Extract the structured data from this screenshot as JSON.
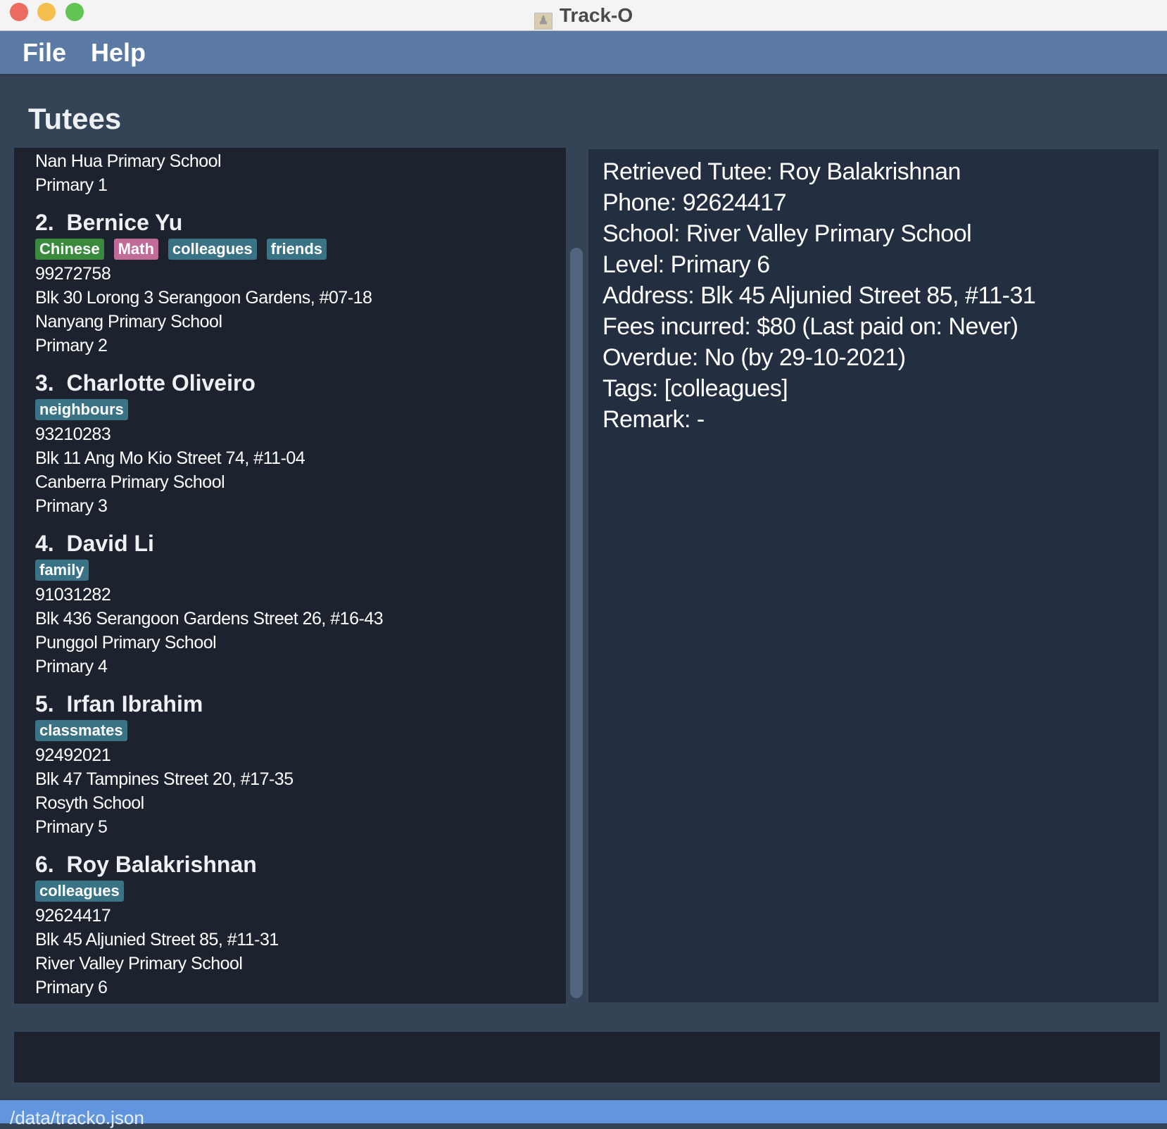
{
  "window": {
    "title": "Track-O"
  },
  "menu": {
    "file": "File",
    "help": "Help"
  },
  "panel": {
    "heading": "Tutees"
  },
  "partial_card": {
    "school": "Nan Hua Primary School",
    "level": "Primary 1"
  },
  "tutees": [
    {
      "index": "2.",
      "name": "Bernice Yu",
      "tags": [
        {
          "label": "Chinese",
          "color": "#3a8a3e"
        },
        {
          "label": "Math",
          "color": "#c06b98"
        },
        {
          "label": "colleagues",
          "color": "#3b7386"
        },
        {
          "label": "friends",
          "color": "#3b7386"
        }
      ],
      "phone": "99272758",
      "address": "Blk 30 Lorong 3 Serangoon Gardens, #07-18",
      "school": "Nanyang Primary School",
      "level": "Primary 2"
    },
    {
      "index": "3.",
      "name": "Charlotte Oliveiro",
      "tags": [
        {
          "label": "neighbours",
          "color": "#3b7386"
        }
      ],
      "phone": "93210283",
      "address": "Blk 11 Ang Mo Kio Street 74, #11-04",
      "school": "Canberra Primary School",
      "level": "Primary 3"
    },
    {
      "index": "4.",
      "name": "David Li",
      "tags": [
        {
          "label": "family",
          "color": "#3b7386"
        }
      ],
      "phone": "91031282",
      "address": "Blk 436 Serangoon Gardens Street 26, #16-43",
      "school": "Punggol Primary School",
      "level": "Primary 4"
    },
    {
      "index": "5.",
      "name": "Irfan Ibrahim",
      "tags": [
        {
          "label": "classmates",
          "color": "#3b7386"
        }
      ],
      "phone": "92492021",
      "address": "Blk 47 Tampines Street 20, #17-35",
      "school": "Rosyth School",
      "level": "Primary 5"
    },
    {
      "index": "6.",
      "name": "Roy Balakrishnan",
      "tags": [
        {
          "label": "colleagues",
          "color": "#3b7386"
        }
      ],
      "phone": "92624417",
      "address": "Blk 45 Aljunied Street 85, #11-31",
      "school": "River Valley Primary School",
      "level": "Primary 6"
    }
  ],
  "result": [
    "Retrieved Tutee: Roy Balakrishnan",
    "Phone: 92624417",
    "School: River Valley Primary School",
    "Level: Primary 6",
    "Address: Blk 45 Aljunied Street 85, #11-31",
    "Fees incurred: $80 (Last paid on: Never)",
    "Overdue: No (by 29-10-2021)",
    "Tags: [colleagues]",
    "Remark: -"
  ],
  "command": {
    "value": ""
  },
  "status": {
    "path": "/data/tracko.json"
  }
}
